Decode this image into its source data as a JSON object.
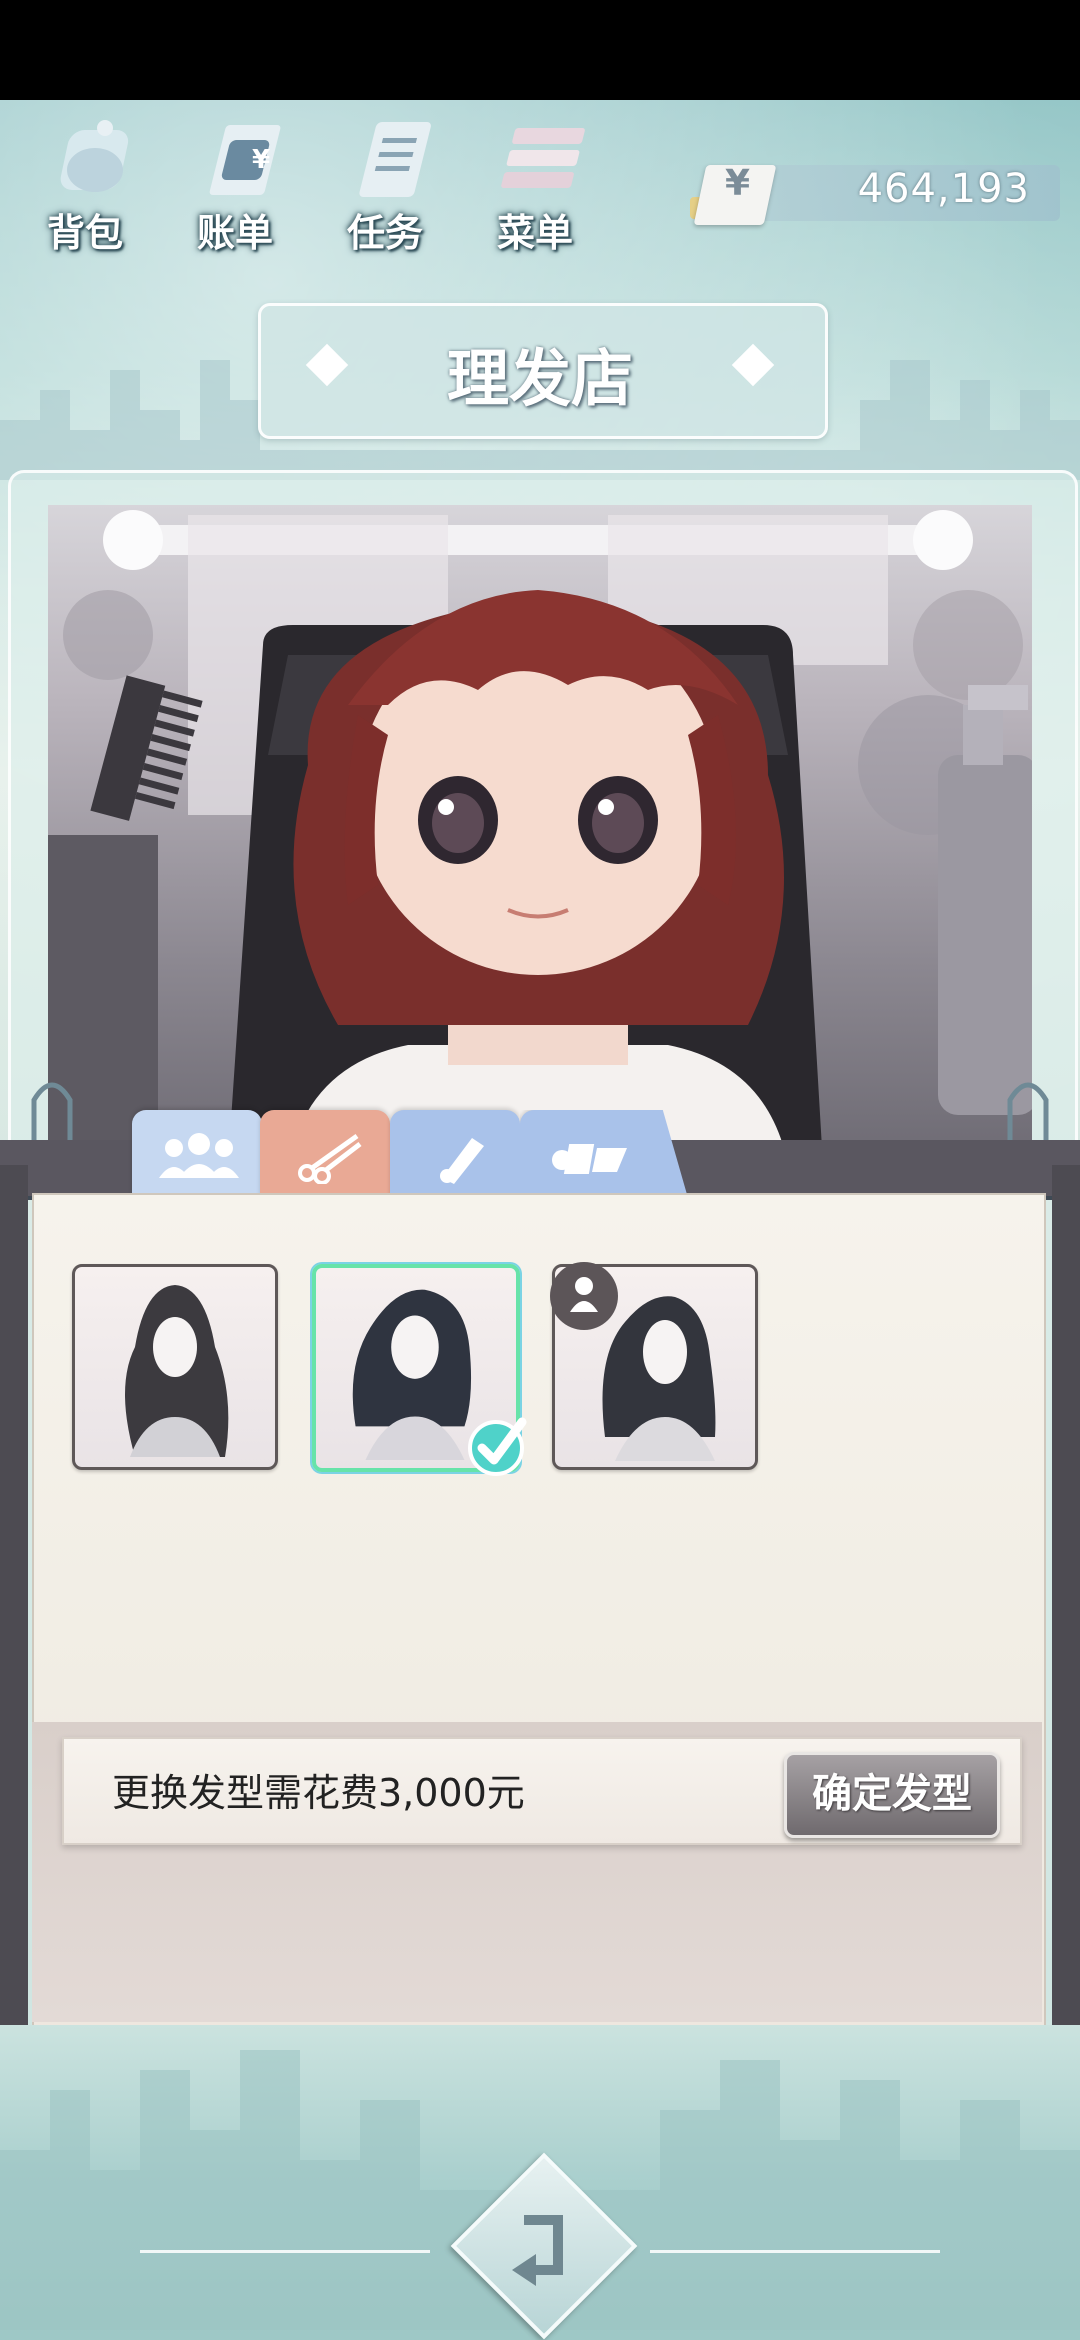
{
  "top_nav": {
    "items": [
      {
        "label": "背包",
        "icon": "bag-icon"
      },
      {
        "label": "账单",
        "icon": "bill-icon"
      },
      {
        "label": "任务",
        "icon": "task-icon"
      },
      {
        "label": "菜单",
        "icon": "menu-icon"
      }
    ]
  },
  "currency": {
    "symbol": "¥",
    "value": "464,193"
  },
  "title": "理发店",
  "tabs": [
    {
      "icon": "people-icon",
      "color": "#c6d8f1"
    },
    {
      "icon": "scissors-icon",
      "color": "#e9a995"
    },
    {
      "icon": "dye-icon",
      "color": "#a9c2ea"
    },
    {
      "icon": "accessories-icon",
      "color": "#a9c2ea"
    }
  ],
  "hairstyles": [
    {
      "icon": "long-wavy-hair-icon",
      "selected": false
    },
    {
      "icon": "shoulder-length-hair-icon",
      "selected": true
    },
    {
      "icon": "long-straight-hair-icon",
      "selected": false,
      "badge": "person-icon"
    }
  ],
  "cost": {
    "text": "更换发型需花费3,000元",
    "confirm_label": "确定发型"
  },
  "colors": {
    "accent_selected": "#67e3a9",
    "panel": "#f6f3ec"
  }
}
